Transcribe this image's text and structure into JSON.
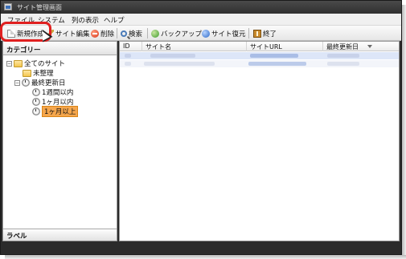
{
  "window": {
    "title": "サイト管理画面"
  },
  "menu": {
    "items": [
      "ファイル",
      "システム",
      "列の表示",
      "ヘルプ"
    ]
  },
  "toolbar": {
    "buttons": [
      {
        "label": "新規作成",
        "icon": "new-document-icon"
      },
      {
        "label": "サイト編集",
        "icon": "edit-pencil-icon"
      },
      {
        "label": "削除",
        "icon": "delete-icon"
      },
      {
        "label": "検索",
        "icon": "search-icon"
      },
      {
        "label": "バックアップ",
        "icon": "backup-icon"
      },
      {
        "label": "サイト復元",
        "icon": "restore-icon"
      },
      {
        "label": "終了",
        "icon": "exit-icon"
      }
    ],
    "highlight_color": "#e02020"
  },
  "left_panel": {
    "header": "カテゴリー",
    "footer": "ラベル",
    "tree": [
      {
        "label": "全てのサイト",
        "level": 0,
        "expanded": true,
        "icon": "folder-icon"
      },
      {
        "label": "未整理",
        "level": 1,
        "icon": "folder-icon"
      },
      {
        "label": "最終更新日",
        "level": 1,
        "expanded": true,
        "icon": "clock-icon"
      },
      {
        "label": "1週間以内",
        "level": 2,
        "icon": "clock-icon"
      },
      {
        "label": "1ヶ月以内",
        "level": 2,
        "icon": "clock-icon"
      },
      {
        "label": "1ヶ月以上",
        "level": 2,
        "icon": "clock-icon",
        "selected": true
      }
    ],
    "selection_color": "#f5a64c"
  },
  "grid": {
    "columns": [
      "ID",
      "サイト名",
      "サイトURL",
      "最終更新日"
    ],
    "sorted_column": "最終更新日",
    "row_count": 2
  },
  "colors": {
    "window_frame": "#2b2b2b",
    "toolbar": "#eeeeee",
    "panel_border": "#9a9a9a"
  }
}
